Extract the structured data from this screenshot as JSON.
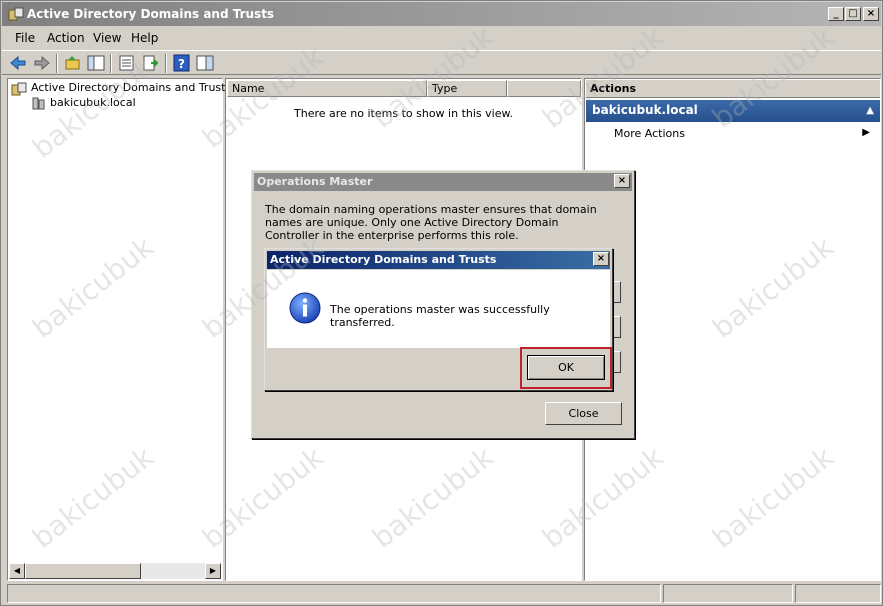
{
  "window": {
    "title": "Active Directory Domains and Trusts"
  },
  "menubar": {
    "items": [
      "File",
      "Action",
      "View",
      "Help"
    ]
  },
  "tree": {
    "root_label": "Active Directory Domains and Trusts [\\",
    "child_label": "bakicubuk.local"
  },
  "list": {
    "columns": [
      "Name",
      "Type"
    ],
    "empty_message": "There are no items to show in this view."
  },
  "actions": {
    "header": "Actions",
    "section_title": "bakicubuk.local",
    "more_actions": "More Actions"
  },
  "operations_master_dialog": {
    "title": "Operations Master",
    "description": "The domain naming operations master ensures that domain names are unique. Only one Active Directory Domain Controller in the enterprise performs this role.",
    "close_label": "Close"
  },
  "message_dialog": {
    "title": "Active Directory Domains and Trusts",
    "message": "The operations master was successfully transferred.",
    "ok_label": "OK"
  },
  "watermark": "bakicubuk",
  "colors": {
    "highlight_border": "#c0222a",
    "actions_section": "#26508c",
    "title_inactive": "#8a8a8a"
  }
}
